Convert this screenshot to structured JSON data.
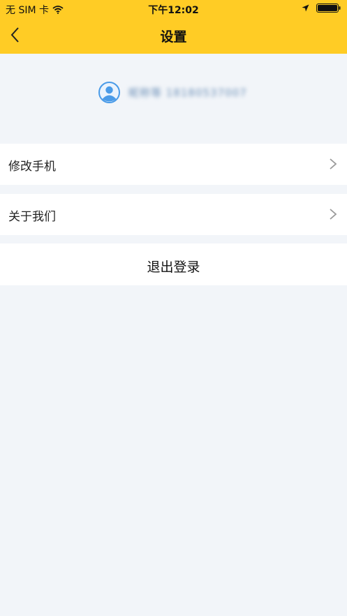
{
  "status_bar": {
    "carrier": "无 SIM 卡",
    "time": "下午12:02"
  },
  "nav": {
    "title": "设置"
  },
  "profile": {
    "name_phone_blurred": "昵称等 18180537007"
  },
  "menu": {
    "items": [
      {
        "label": "修改手机"
      },
      {
        "label": "关于我们"
      }
    ]
  },
  "logout": {
    "label": "退出登录"
  },
  "colors": {
    "header_bg": "#ffcc25",
    "page_bg": "#f2f5f9",
    "avatar_blue": "#4a9be8"
  }
}
